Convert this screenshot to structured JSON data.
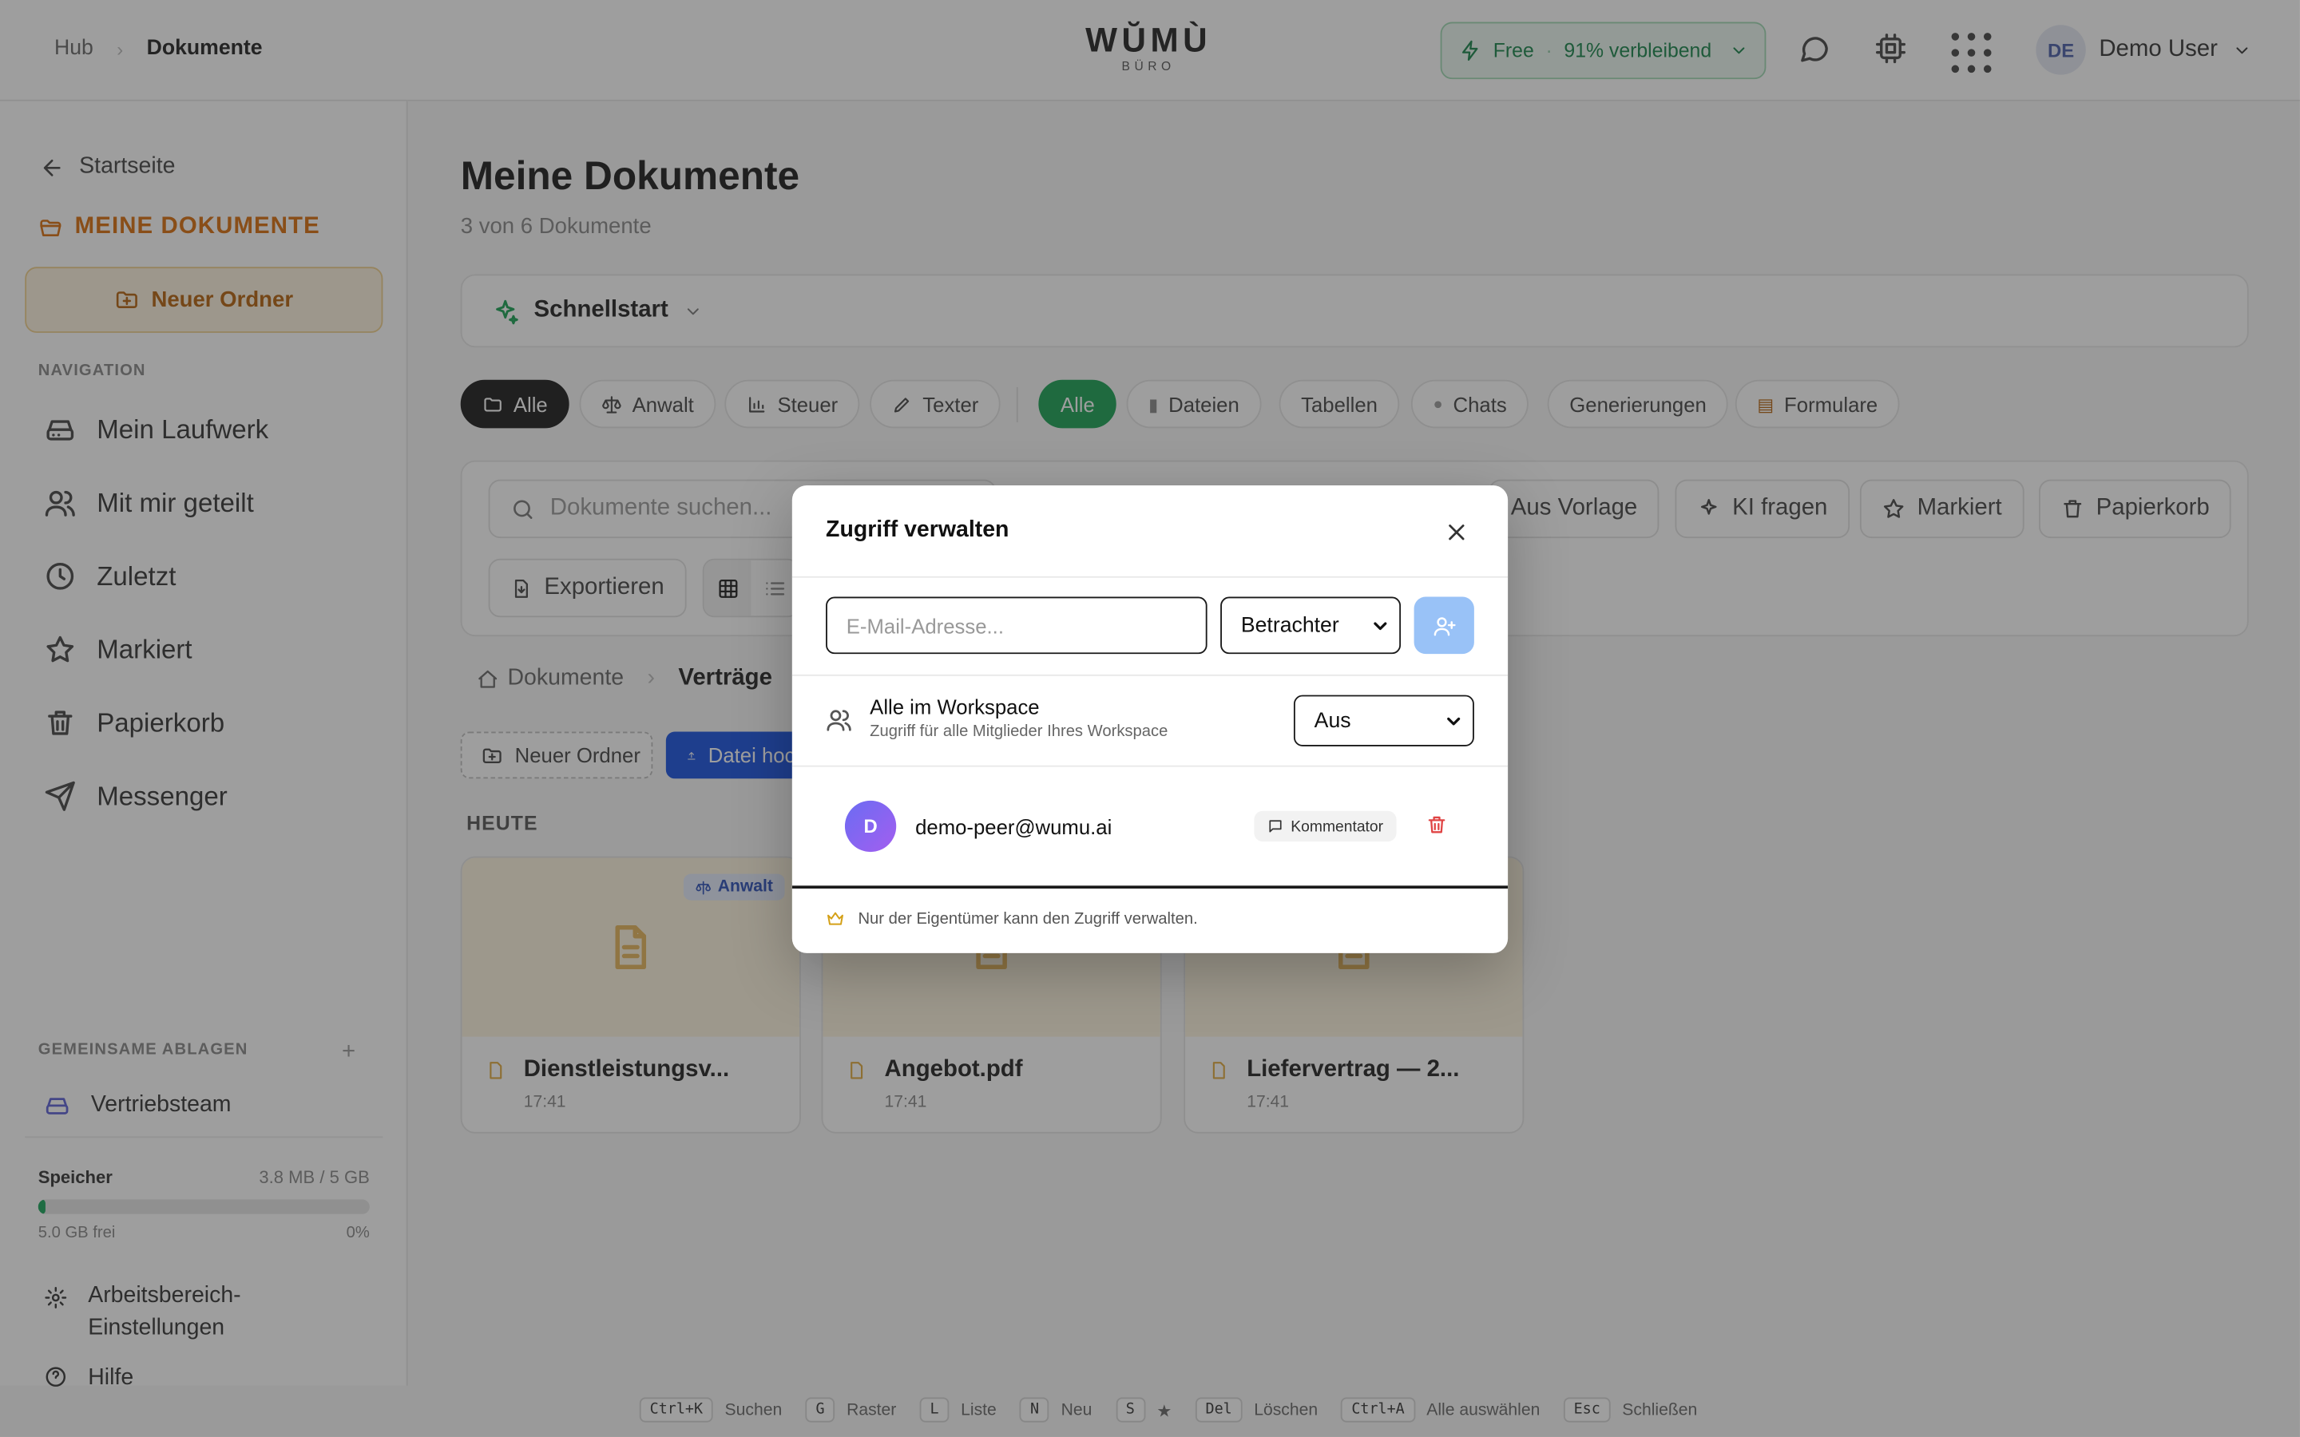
{
  "header": {
    "breadcrumb": [
      "Hub",
      "Dokumente"
    ],
    "logo_main": "WŬMÙ",
    "logo_sub": "BÜRO",
    "plan_label": "Free",
    "plan_dot": "·",
    "plan_remaining": "91% verbleibend",
    "user_initials": "DE",
    "user_name": "Demo User"
  },
  "sidebar": {
    "home_label": "Startseite",
    "title": "MEINE DOKUMENTE",
    "new_folder_label": "Neuer Ordner",
    "nav_heading": "NAVIGATION",
    "nav_items": [
      {
        "label": "Mein Laufwerk",
        "icon": "drive-icon"
      },
      {
        "label": "Mit mir geteilt",
        "icon": "users-icon"
      },
      {
        "label": "Zuletzt",
        "icon": "clock-icon"
      },
      {
        "label": "Markiert",
        "icon": "star-icon"
      },
      {
        "label": "Papierkorb",
        "icon": "trash-icon"
      },
      {
        "label": "Messenger",
        "icon": "send-icon"
      }
    ],
    "shared_heading": "GEMEINSAME ABLAGEN",
    "shared_add": "+",
    "shared_item": "Vertriebsteam",
    "storage_label": "Speicher",
    "storage_used": "3.8 MB / 5 GB",
    "storage_fraction": 0.001,
    "storage_free": "5.0 GB frei",
    "storage_percent": "0%",
    "settings_line1": "Arbeitsbereich-",
    "settings_line2": "Einstellungen",
    "help_label": "Hilfe"
  },
  "main": {
    "title": "Meine Dokumente",
    "subtitle": "3 von 6 Dokumente",
    "quickstart": "Schnellstart",
    "filter_chips": [
      "Alle",
      "Anwalt",
      "Steuer",
      "Texter"
    ],
    "type_chips": [
      "Alle",
      "Dateien",
      "Tabellen",
      "Chats",
      "Generierungen",
      "Formulare"
    ],
    "search_placeholder": "Dokumente suchen...",
    "toolbar_buttons": [
      "Aus Vorlage",
      "KI fragen",
      "Markiert",
      "Papierkorb"
    ],
    "export_label": "Exportieren",
    "breadcrumb": [
      "Dokumente",
      "Verträge"
    ],
    "new_folder_label": "Neuer Ordner",
    "upload_label": "Datei hochladen",
    "section_today": "HEUTE",
    "files": [
      {
        "name": "Dienstleistungsv...",
        "time": "17:41",
        "tag": "Anwalt"
      },
      {
        "name": "Angebot.pdf",
        "time": "17:41",
        "tag": ""
      },
      {
        "name": "Liefervertrag — 2...",
        "time": "17:41",
        "tag": ""
      }
    ]
  },
  "shortcuts": [
    {
      "key": "Ctrl+K",
      "label": "Suchen"
    },
    {
      "key": "G",
      "label": "Raster"
    },
    {
      "key": "L",
      "label": "Liste"
    },
    {
      "key": "N",
      "label": "Neu"
    },
    {
      "key": "S",
      "label": "★"
    },
    {
      "key": "Del",
      "label": "Löschen"
    },
    {
      "key": "Ctrl+A",
      "label": "Alle auswählen"
    },
    {
      "key": "Esc",
      "label": "Schließen"
    }
  ],
  "modal": {
    "title": "Zugriff verwalten",
    "email_placeholder": "E-Mail-Adresse...",
    "role_value": "Betrachter",
    "workspace_title": "Alle im Workspace",
    "workspace_subtitle": "Zugriff für alle Mitglieder Ihres Workspace",
    "workspace_value": "Aus",
    "member_initial": "D",
    "member_email": "demo-peer@wumu.ai",
    "member_role": "Kommentator",
    "footer_note": "Nur der Eigentümer kann den Zugriff verwalten."
  },
  "colors": {
    "accent_orange": "#d96d0c",
    "plan_green": "#17844a",
    "primary_blue": "#1650e0",
    "chip_green": "#18a152",
    "danger": "#e04444"
  }
}
